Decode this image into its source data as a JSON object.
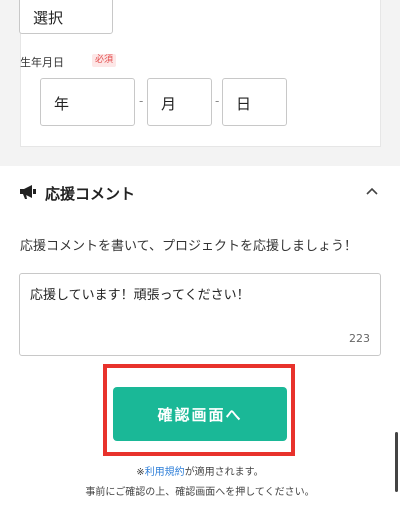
{
  "profile": {
    "select_value": "選択",
    "dob_label": "生年月日",
    "required_badge": "必須",
    "year": "年",
    "month": "月",
    "day": "日",
    "separator": "-"
  },
  "comment_section": {
    "title": "応援コメント",
    "intro": "応援コメントを書いて、プロジェクトを応援しましょう！",
    "comment_value": "応援しています！頑張ってください！",
    "char_count": "223"
  },
  "actions": {
    "confirm_label": "確認画面へ"
  },
  "notes": {
    "terms_prefix": "※",
    "terms_link": "利用規約",
    "terms_suffix": "が適用されます。",
    "confirm_note": "事前にご確認の上、確認画面へを押してください。"
  },
  "colors": {
    "accent": "#1ab897",
    "highlight": "#e8322c",
    "required": "#e24a4a",
    "link": "#2f7fd8"
  },
  "icons": {
    "section": "megaphone-icon",
    "toggle": "chevron-up-icon"
  }
}
